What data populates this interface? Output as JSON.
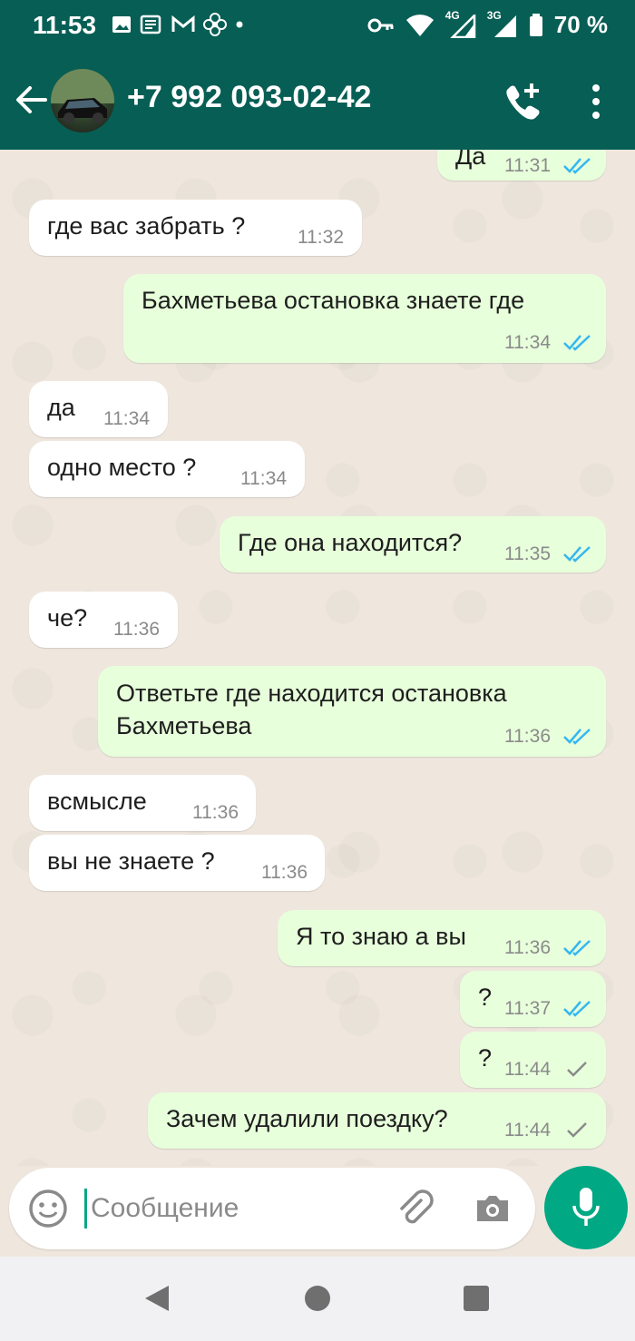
{
  "status_bar": {
    "time": "11:53",
    "network_4g": "4G",
    "network_3g": "3G",
    "battery": "70 %"
  },
  "header": {
    "contact": "+7 992 093-02-42"
  },
  "messages": [
    {
      "dir": "out",
      "text": "Да",
      "time": "11:31",
      "ticks": "double-blue"
    },
    {
      "dir": "in",
      "text": "где вас забрать ?",
      "time": "11:32"
    },
    {
      "dir": "out",
      "text": "Бахметьева остановка знаете где",
      "time": "11:34",
      "ticks": "double-blue"
    },
    {
      "dir": "in",
      "text": "да",
      "time": "11:34"
    },
    {
      "dir": "in",
      "text": "одно место ?",
      "time": "11:34"
    },
    {
      "dir": "out",
      "text": "Где она находится?",
      "time": "11:35",
      "ticks": "double-blue"
    },
    {
      "dir": "in",
      "text": "че?",
      "time": "11:36"
    },
    {
      "dir": "out",
      "text": "Ответьте где находится остановка Бахметьева",
      "time": "11:36",
      "ticks": "double-blue"
    },
    {
      "dir": "in",
      "text": "всмысле",
      "time": "11:36"
    },
    {
      "dir": "in",
      "text": "вы не знаете ?",
      "time": "11:36"
    },
    {
      "dir": "out",
      "text": "Я то знаю а вы",
      "time": "11:36",
      "ticks": "double-blue"
    },
    {
      "dir": "out",
      "text": "?",
      "time": "11:37",
      "ticks": "double-blue"
    },
    {
      "dir": "out",
      "text": "?",
      "time": "11:44",
      "ticks": "single-grey"
    },
    {
      "dir": "out",
      "text": "Зачем удалили поездку?",
      "time": "11:44",
      "ticks": "single-grey"
    }
  ],
  "composer": {
    "placeholder": "Сообщение"
  },
  "colors": {
    "header": "#075e54",
    "outgoing_bubble": "#e7ffdb",
    "incoming_bubble": "#ffffff",
    "accent": "#00a884",
    "read_ticks": "#34b7f1"
  }
}
